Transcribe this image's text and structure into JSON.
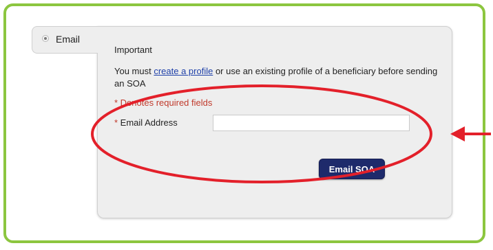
{
  "tab": {
    "label": "Email",
    "selected": true
  },
  "panel": {
    "heading": "Important",
    "message_before_link": "You must ",
    "link_text": "create a profile",
    "message_after_link": " or use an existing profile of a beneficiary before sending an SOA",
    "required_note": "* Denotes required fields",
    "email_field": {
      "asterisk": "*",
      "label": " Email Address",
      "value": ""
    },
    "submit_label": "Email SOA"
  },
  "colors": {
    "frame_border": "#8cc63f",
    "annotation": "#e3202a",
    "button": "#1e2a6b",
    "link": "#1d3fa8",
    "required": "#c0392b"
  },
  "icons": {
    "annotation_arrow": "left-arrow-icon",
    "annotation_circle": "highlight-ellipse"
  }
}
